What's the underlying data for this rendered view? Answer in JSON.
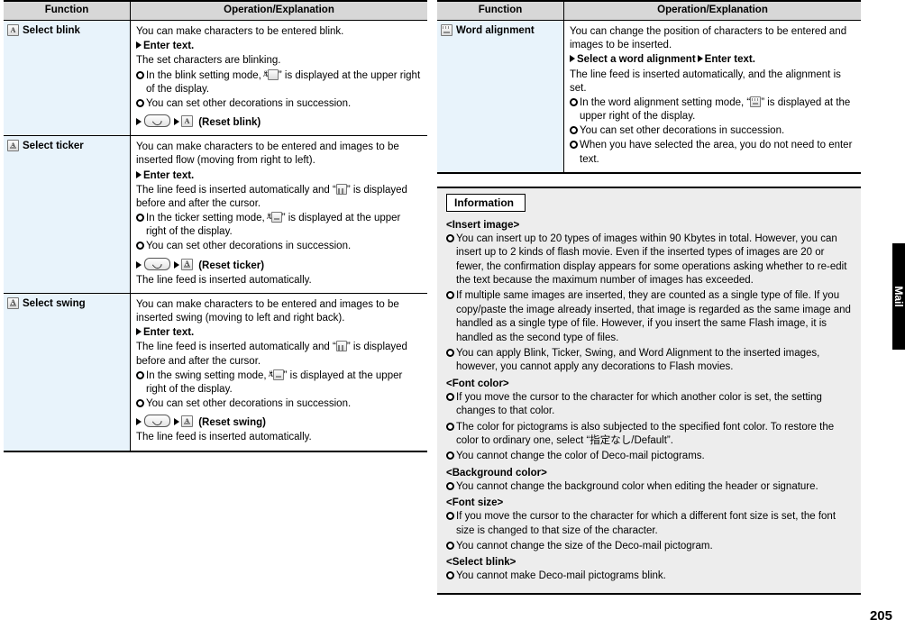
{
  "columns": {
    "left": {
      "table": {
        "headers": {
          "function": "Function",
          "operation": "Operation/Explanation"
        },
        "rows": [
          {
            "name": "Select blink",
            "icon": "blink-icon",
            "lines": [
              {
                "type": "text",
                "text": "You can make characters to be entered blink."
              },
              {
                "type": "step",
                "text": "Enter text."
              },
              {
                "type": "text",
                "text": "The set characters are blinking."
              },
              {
                "type": "bullet",
                "text": "In the blink setting mode, “",
                "icon": "blink-icon",
                "text2": "” is displayed at the upper right of the display."
              },
              {
                "type": "bullet",
                "text": "You can set other decorations in succession."
              },
              {
                "type": "reset",
                "text": "(Reset blink)",
                "icon": "blink-icon"
              }
            ]
          },
          {
            "name": "Select ticker",
            "icon": "ticker-icon",
            "lines": [
              {
                "type": "text",
                "text": "You can make characters to be entered and images to be inserted flow (moving from right to left)."
              },
              {
                "type": "step",
                "text": "Enter text."
              },
              {
                "type": "text",
                "text": "The line feed is inserted automatically and “",
                "icon": "ticker-mark-icon",
                "text2": "” is displayed before and after the cursor."
              },
              {
                "type": "bullet",
                "text": "In the ticker setting mode, “",
                "icon": "ticker-icon",
                "text2": "” is displayed at the upper right of the display."
              },
              {
                "type": "bullet",
                "text": "You can set other decorations in succession."
              },
              {
                "type": "reset",
                "text": "(Reset ticker)",
                "icon": "ticker-icon"
              },
              {
                "type": "text",
                "text": "The line feed is inserted automatically."
              }
            ]
          },
          {
            "name": "Select swing",
            "icon": "swing-icon",
            "lines": [
              {
                "type": "text",
                "text": "You can make characters to be entered and images to be inserted swing (moving to left and right back)."
              },
              {
                "type": "step",
                "text": "Enter text."
              },
              {
                "type": "text",
                "text": "The line feed is inserted automatically and “",
                "icon": "swing-mark-icon",
                "text2": "” is displayed before and after the cursor."
              },
              {
                "type": "bullet",
                "text": "In the swing setting mode, “",
                "icon": "swing-icon",
                "text2": "” is displayed at the upper right of the display."
              },
              {
                "type": "bullet",
                "text": "You can set other decorations in succession."
              },
              {
                "type": "reset",
                "text": "(Reset swing)",
                "icon": "swing-icon"
              },
              {
                "type": "text",
                "text": "The line feed is inserted automatically."
              }
            ]
          }
        ]
      }
    },
    "right": {
      "table": {
        "headers": {
          "function": "Function",
          "operation": "Operation/Explanation"
        },
        "rows": [
          {
            "name": "Word alignment",
            "icon": "word-alignment-icon",
            "lines": [
              {
                "type": "text",
                "text": "You can change the position of characters to be entered and images to be inserted."
              },
              {
                "type": "step2",
                "text": "Select a word alignment",
                "text2": "Enter text."
              },
              {
                "type": "text",
                "text": "The line feed is inserted automatically, and the alignment is set."
              },
              {
                "type": "bullet",
                "text": "In the word alignment setting mode, “",
                "icon": "word-alignment-icon",
                "text2": "” is displayed at the upper right of the display."
              },
              {
                "type": "bullet",
                "text": "You can set other decorations in succession."
              },
              {
                "type": "bullet",
                "text": "When you have selected the area, you do not need to enter text."
              }
            ]
          }
        ]
      },
      "information": {
        "title": "Information",
        "sections": [
          {
            "heading": "<Insert image>",
            "items": [
              "You can insert up to 20 types of images within 90 Kbytes in total. However, you can insert up to 2 kinds of flash movie. Even if the inserted types of images are 20 or fewer, the confirmation display appears for some operations asking whether to re-edit the text because the maximum number of images has exceeded.",
              "If multiple same images are inserted, they are counted as a single type of file. If you copy/paste the image already inserted, that image is regarded as the same image and handled as a single type of file. However, if you insert the same Flash image, it is handled as the second type of files.",
              "You can apply Blink, Ticker, Swing, and Word Alignment to the inserted images, however, you cannot apply any decorations to Flash movies."
            ]
          },
          {
            "heading": "<Font color>",
            "items": [
              "If you move the cursor to the character for which another color is set, the setting changes to that color.",
              "The color for pictograms is also subjected to the specified font color. To restore the color to ordinary one, select “指定なし/Default”.",
              "You cannot change the color of Deco-mail pictograms."
            ]
          },
          {
            "heading": "<Background color>",
            "items": [
              "You cannot change the background color when editing the header or signature."
            ]
          },
          {
            "heading": "<Font size>",
            "items": [
              "If you move the cursor to the character for which a different font size is set, the font size is changed to that size of the character.",
              "You cannot change the size of the Deco-mail pictogram."
            ]
          },
          {
            "heading": "<Select blink>",
            "items": [
              "You cannot make Deco-mail pictograms blink."
            ]
          }
        ]
      }
    }
  },
  "side_tab": {
    "label": "Mail"
  },
  "page_number": "205"
}
